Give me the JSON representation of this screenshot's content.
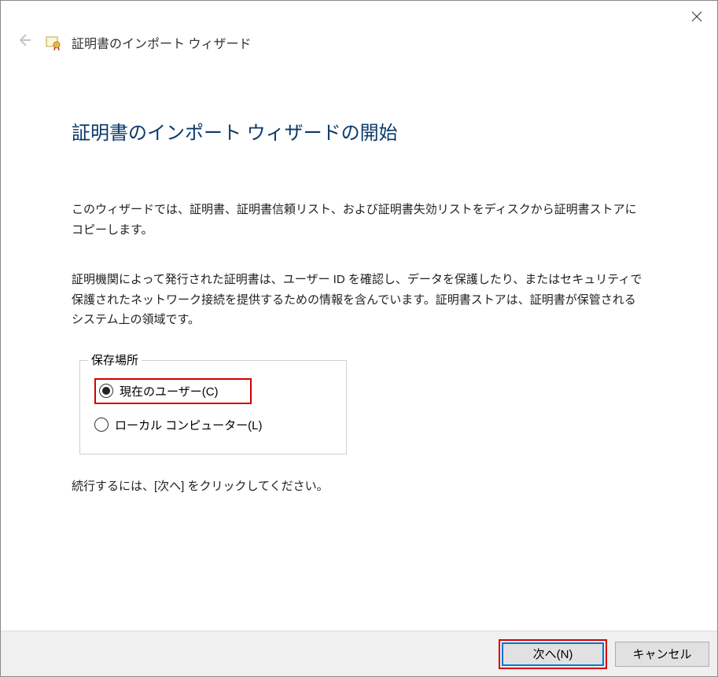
{
  "window": {
    "wizard_title": "証明書のインポート ウィザード"
  },
  "page": {
    "heading": "証明書のインポート ウィザードの開始",
    "paragraph1": "このウィザードでは、証明書、証明書信頼リスト、および証明書失効リストをディスクから証明書ストアにコピーします。",
    "paragraph2": "証明機関によって発行された証明書は、ユーザー ID を確認し、データを保護したり、またはセキュリティで保護されたネットワーク接続を提供するための情報を含んでいます。証明書ストアは、証明書が保管されるシステム上の領域です。",
    "continue_text": "続行するには、[次へ] をクリックしてください。"
  },
  "store_location": {
    "legend": "保存場所",
    "options": [
      {
        "label": "現在のユーザー(C)",
        "selected": true
      },
      {
        "label": "ローカル コンピューター(L)",
        "selected": false
      }
    ]
  },
  "buttons": {
    "next": "次へ(N)",
    "cancel": "キャンセル"
  }
}
